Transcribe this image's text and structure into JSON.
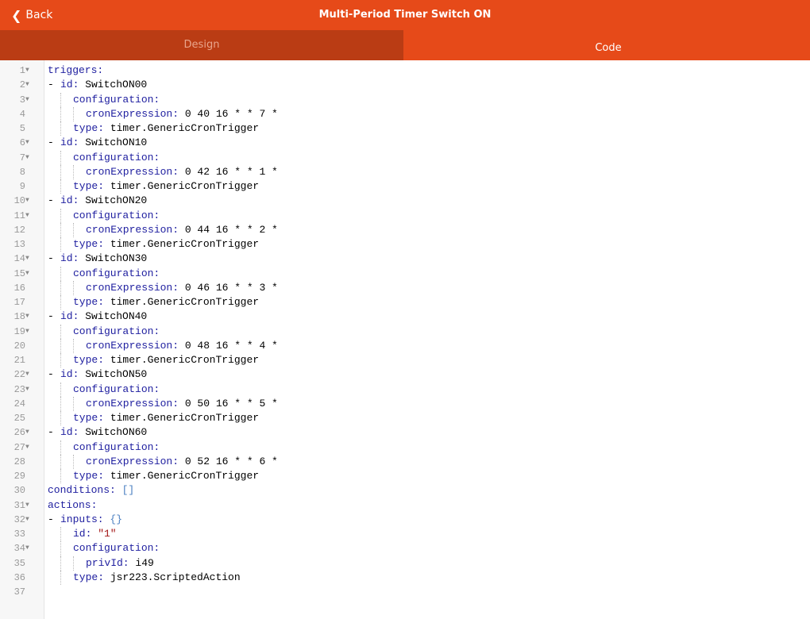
{
  "header": {
    "back_label": "Back",
    "title": "Multi-Period Timer Switch ON"
  },
  "tabs": [
    {
      "label": "Design"
    },
    {
      "label": "Code"
    }
  ],
  "colors": {
    "header": "#e64a19",
    "inactive_tab": "#ba3c14"
  },
  "lines": [
    {
      "n": "1",
      "fold": true,
      "ind": 0,
      "dash": false,
      "key": "triggers:",
      "val": "",
      "vt": ""
    },
    {
      "n": "2",
      "fold": true,
      "ind": 1,
      "dash": true,
      "key": "id:",
      "val": " SwitchON00",
      "vt": ""
    },
    {
      "n": "3",
      "fold": true,
      "ind": 2,
      "dash": false,
      "key": "configuration:",
      "val": "",
      "vt": ""
    },
    {
      "n": "4",
      "fold": false,
      "ind": 3,
      "dash": false,
      "key": "cronExpression:",
      "val": " 0 40 16 * * 7 *",
      "vt": ""
    },
    {
      "n": "5",
      "fold": false,
      "ind": 2,
      "dash": false,
      "key": "type:",
      "val": " timer.GenericCronTrigger",
      "vt": ""
    },
    {
      "n": "6",
      "fold": true,
      "ind": 1,
      "dash": true,
      "key": "id:",
      "val": " SwitchON10",
      "vt": ""
    },
    {
      "n": "7",
      "fold": true,
      "ind": 2,
      "dash": false,
      "key": "configuration:",
      "val": "",
      "vt": ""
    },
    {
      "n": "8",
      "fold": false,
      "ind": 3,
      "dash": false,
      "key": "cronExpression:",
      "val": " 0 42 16 * * 1 *",
      "vt": ""
    },
    {
      "n": "9",
      "fold": false,
      "ind": 2,
      "dash": false,
      "key": "type:",
      "val": " timer.GenericCronTrigger",
      "vt": ""
    },
    {
      "n": "10",
      "fold": true,
      "ind": 1,
      "dash": true,
      "key": "id:",
      "val": " SwitchON20",
      "vt": ""
    },
    {
      "n": "11",
      "fold": true,
      "ind": 2,
      "dash": false,
      "key": "configuration:",
      "val": "",
      "vt": ""
    },
    {
      "n": "12",
      "fold": false,
      "ind": 3,
      "dash": false,
      "key": "cronExpression:",
      "val": " 0 44 16 * * 2 *",
      "vt": ""
    },
    {
      "n": "13",
      "fold": false,
      "ind": 2,
      "dash": false,
      "key": "type:",
      "val": " timer.GenericCronTrigger",
      "vt": ""
    },
    {
      "n": "14",
      "fold": true,
      "ind": 1,
      "dash": true,
      "key": "id:",
      "val": " SwitchON30",
      "vt": ""
    },
    {
      "n": "15",
      "fold": true,
      "ind": 2,
      "dash": false,
      "key": "configuration:",
      "val": "",
      "vt": ""
    },
    {
      "n": "16",
      "fold": false,
      "ind": 3,
      "dash": false,
      "key": "cronExpression:",
      "val": " 0 46 16 * * 3 *",
      "vt": ""
    },
    {
      "n": "17",
      "fold": false,
      "ind": 2,
      "dash": false,
      "key": "type:",
      "val": " timer.GenericCronTrigger",
      "vt": ""
    },
    {
      "n": "18",
      "fold": true,
      "ind": 1,
      "dash": true,
      "key": "id:",
      "val": " SwitchON40",
      "vt": ""
    },
    {
      "n": "19",
      "fold": true,
      "ind": 2,
      "dash": false,
      "key": "configuration:",
      "val": "",
      "vt": ""
    },
    {
      "n": "20",
      "fold": false,
      "ind": 3,
      "dash": false,
      "key": "cronExpression:",
      "val": " 0 48 16 * * 4 *",
      "vt": ""
    },
    {
      "n": "21",
      "fold": false,
      "ind": 2,
      "dash": false,
      "key": "type:",
      "val": " timer.GenericCronTrigger",
      "vt": ""
    },
    {
      "n": "22",
      "fold": true,
      "ind": 1,
      "dash": true,
      "key": "id:",
      "val": " SwitchON50",
      "vt": ""
    },
    {
      "n": "23",
      "fold": true,
      "ind": 2,
      "dash": false,
      "key": "configuration:",
      "val": "",
      "vt": ""
    },
    {
      "n": "24",
      "fold": false,
      "ind": 3,
      "dash": false,
      "key": "cronExpression:",
      "val": " 0 50 16 * * 5 *",
      "vt": ""
    },
    {
      "n": "25",
      "fold": false,
      "ind": 2,
      "dash": false,
      "key": "type:",
      "val": " timer.GenericCronTrigger",
      "vt": ""
    },
    {
      "n": "26",
      "fold": true,
      "ind": 1,
      "dash": true,
      "key": "id:",
      "val": " SwitchON60",
      "vt": ""
    },
    {
      "n": "27",
      "fold": true,
      "ind": 2,
      "dash": false,
      "key": "configuration:",
      "val": "",
      "vt": ""
    },
    {
      "n": "28",
      "fold": false,
      "ind": 3,
      "dash": false,
      "key": "cronExpression:",
      "val": " 0 52 16 * * 6 *",
      "vt": ""
    },
    {
      "n": "29",
      "fold": false,
      "ind": 2,
      "dash": false,
      "key": "type:",
      "val": " timer.GenericCronTrigger",
      "vt": ""
    },
    {
      "n": "30",
      "fold": false,
      "ind": 0,
      "dash": false,
      "key": "conditions:",
      "val": " []",
      "vt": "br"
    },
    {
      "n": "31",
      "fold": true,
      "ind": 0,
      "dash": false,
      "key": "actions:",
      "val": "",
      "vt": ""
    },
    {
      "n": "32",
      "fold": true,
      "ind": 1,
      "dash": true,
      "key": "inputs:",
      "val": " {}",
      "vt": "br"
    },
    {
      "n": "33",
      "fold": false,
      "ind": 2,
      "dash": false,
      "key": "id:",
      "val": " \"1\"",
      "vt": "str"
    },
    {
      "n": "34",
      "fold": true,
      "ind": 2,
      "dash": false,
      "key": "configuration:",
      "val": "",
      "vt": ""
    },
    {
      "n": "35",
      "fold": false,
      "ind": 3,
      "dash": false,
      "key": "privId:",
      "val": " i49",
      "vt": ""
    },
    {
      "n": "36",
      "fold": false,
      "ind": 2,
      "dash": false,
      "key": "type:",
      "val": " jsr223.ScriptedAction",
      "vt": ""
    },
    {
      "n": "37",
      "fold": false,
      "ind": 0,
      "dash": false,
      "key": "",
      "val": "",
      "vt": ""
    }
  ]
}
